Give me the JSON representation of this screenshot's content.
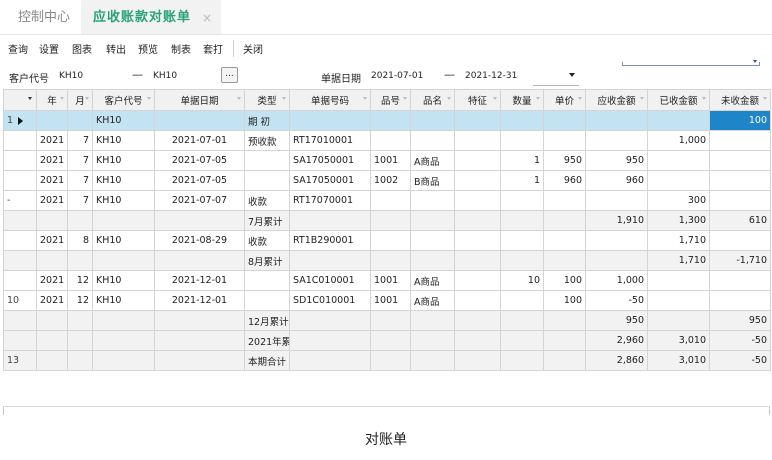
{
  "tabs": {
    "home": "控制中心",
    "active": "应收账款对账单",
    "close_glyph": "×"
  },
  "menu": [
    "查询",
    "设置",
    "图表",
    "转出",
    "预览",
    "制表",
    "套打",
    "关闭"
  ],
  "filter": {
    "customer_label": "客户代号",
    "customer_from": "KH10",
    "dash": "—",
    "customer_to": "KH10",
    "ellipsis": "...",
    "date_label": "单据日期",
    "date_from": "2021-07-01",
    "date_to": "2021-12-31"
  },
  "columns": [
    "",
    "年",
    "月",
    "客户代号",
    "单据日期",
    "类型",
    "单据号码",
    "品号",
    "品名",
    "特征",
    "数量",
    "单价",
    "应收金额",
    "已收金额",
    "未收金额"
  ],
  "rows": [
    {
      "ind": "1",
      "ptr": true,
      "year": "",
      "month": "",
      "cust": "KH10",
      "date": "",
      "type": "期 初",
      "no": "",
      "item": "",
      "name": "",
      "feat": "",
      "qty": "",
      "price": "",
      "recv": "",
      "paid": "",
      "unpaid": "100",
      "style": "sel"
    },
    {
      "ind": "",
      "year": "2021",
      "month": "7",
      "cust": "KH10",
      "date": "2021-07-01",
      "type": "预收款",
      "no": "RT17010001",
      "item": "",
      "name": "",
      "feat": "",
      "qty": "",
      "price": "",
      "recv": "",
      "paid": "1,000",
      "unpaid": ""
    },
    {
      "ind": "",
      "year": "2021",
      "month": "7",
      "cust": "KH10",
      "date": "2021-07-05",
      "type": "",
      "no": "SA17050001",
      "item": "1001",
      "name": "A商品",
      "feat": "",
      "qty": "1",
      "price": "950",
      "recv": "950",
      "paid": "",
      "unpaid": ""
    },
    {
      "ind": "",
      "year": "2021",
      "month": "7",
      "cust": "KH10",
      "date": "2021-07-05",
      "type": "",
      "no": "SA17050001",
      "item": "1002",
      "name": "B商品",
      "feat": "",
      "qty": "1",
      "price": "960",
      "recv": "960",
      "paid": "",
      "unpaid": ""
    },
    {
      "ind": "-",
      "year": "2021",
      "month": "7",
      "cust": "KH10",
      "date": "2021-07-07",
      "type": "收款",
      "no": "RT17070001",
      "item": "",
      "name": "",
      "feat": "",
      "qty": "",
      "price": "",
      "recv": "",
      "paid": "300",
      "unpaid": ""
    },
    {
      "ind": "",
      "year": "",
      "month": "",
      "cust": "",
      "date": "",
      "type": "7月累计",
      "no": "",
      "item": "",
      "name": "",
      "feat": "",
      "qty": "",
      "price": "",
      "recv": "1,910",
      "paid": "1,300",
      "unpaid": "610",
      "style": "sum"
    },
    {
      "ind": "",
      "year": "2021",
      "month": "8",
      "cust": "KH10",
      "date": "2021-08-29",
      "type": "收款",
      "no": "RT1B290001",
      "item": "",
      "name": "",
      "feat": "",
      "qty": "",
      "price": "",
      "recv": "",
      "paid": "1,710",
      "unpaid": ""
    },
    {
      "ind": "",
      "year": "",
      "month": "",
      "cust": "",
      "date": "",
      "type": "8月累计",
      "no": "",
      "item": "",
      "name": "",
      "feat": "",
      "qty": "",
      "price": "",
      "recv": "",
      "paid": "1,710",
      "unpaid": "-1,710",
      "style": "sum"
    },
    {
      "ind": "",
      "year": "2021",
      "month": "12",
      "cust": "KH10",
      "date": "2021-12-01",
      "type": "",
      "no": "SA1C010001",
      "item": "1001",
      "name": "A商品",
      "feat": "",
      "qty": "10",
      "price": "100",
      "recv": "1,000",
      "paid": "",
      "unpaid": ""
    },
    {
      "ind": "10",
      "year": "2021",
      "month": "12",
      "cust": "KH10",
      "date": "2021-12-01",
      "type": "",
      "no": "SD1C010001",
      "item": "1001",
      "name": "A商品",
      "feat": "",
      "qty": "",
      "price": "100",
      "recv": "-50",
      "paid": "",
      "unpaid": ""
    },
    {
      "ind": "",
      "year": "",
      "month": "",
      "cust": "",
      "date": "",
      "type": "12月累计",
      "no": "",
      "item": "",
      "name": "",
      "feat": "",
      "qty": "",
      "price": "",
      "recv": "950",
      "paid": "",
      "unpaid": "950",
      "style": "sum"
    },
    {
      "ind": "",
      "year": "",
      "month": "",
      "cust": "",
      "date": "",
      "type": "2021年累",
      "no": "",
      "item": "",
      "name": "",
      "feat": "",
      "qty": "",
      "price": "",
      "recv": "2,960",
      "paid": "3,010",
      "unpaid": "-50",
      "style": "sum"
    },
    {
      "ind": "13",
      "year": "",
      "month": "",
      "cust": "",
      "date": "",
      "type": "本期合计",
      "no": "",
      "item": "",
      "name": "",
      "feat": "",
      "qty": "",
      "price": "",
      "recv": "2,860",
      "paid": "3,010",
      "unpaid": "-50",
      "style": "sum"
    }
  ],
  "footer_title": "对账单",
  "colors": {
    "accent": "#2aa37a",
    "selected_row": "#c4e3f2",
    "current_cell": "#1e86c8",
    "summary_row": "#f2f2f2"
  }
}
